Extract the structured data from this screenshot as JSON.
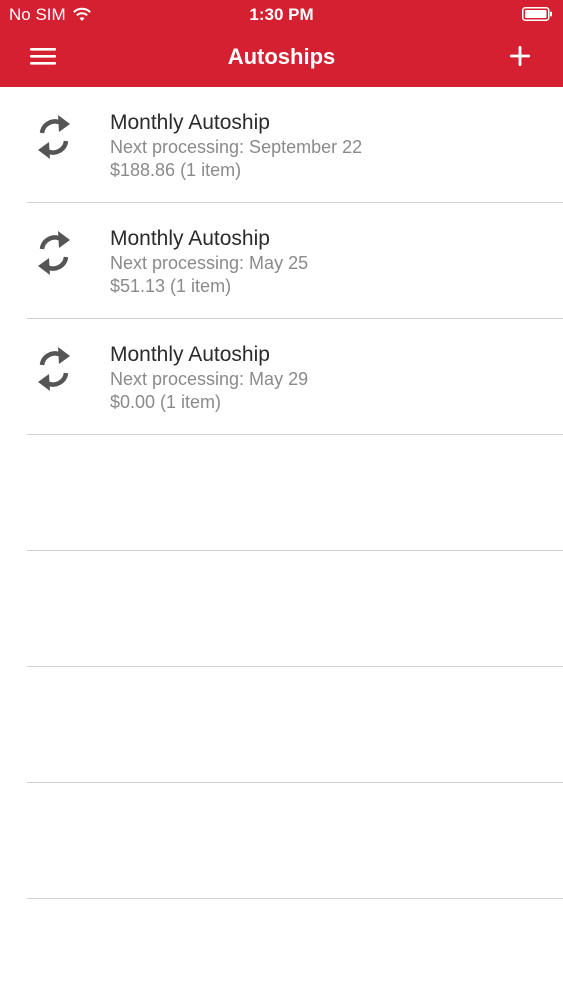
{
  "status_bar": {
    "carrier": "No SIM",
    "time": "1:30 PM"
  },
  "header": {
    "title": "Autoships",
    "background_color": "#d42030",
    "menu_icon": "hamburger-menu-icon",
    "add_icon": "plus-icon"
  },
  "autoships": [
    {
      "title": "Monthly Autoship",
      "next_processing": "Next processing: September 22",
      "summary": "$188.86 (1 item)",
      "icon": "sync-icon"
    },
    {
      "title": "Monthly Autoship",
      "next_processing": "Next processing: May 25",
      "summary": "$51.13 (1 item)",
      "icon": "sync-icon"
    },
    {
      "title": "Monthly Autoship",
      "next_processing": "Next processing: May 29",
      "summary": "$0.00 (1 item)",
      "icon": "sync-icon"
    }
  ]
}
